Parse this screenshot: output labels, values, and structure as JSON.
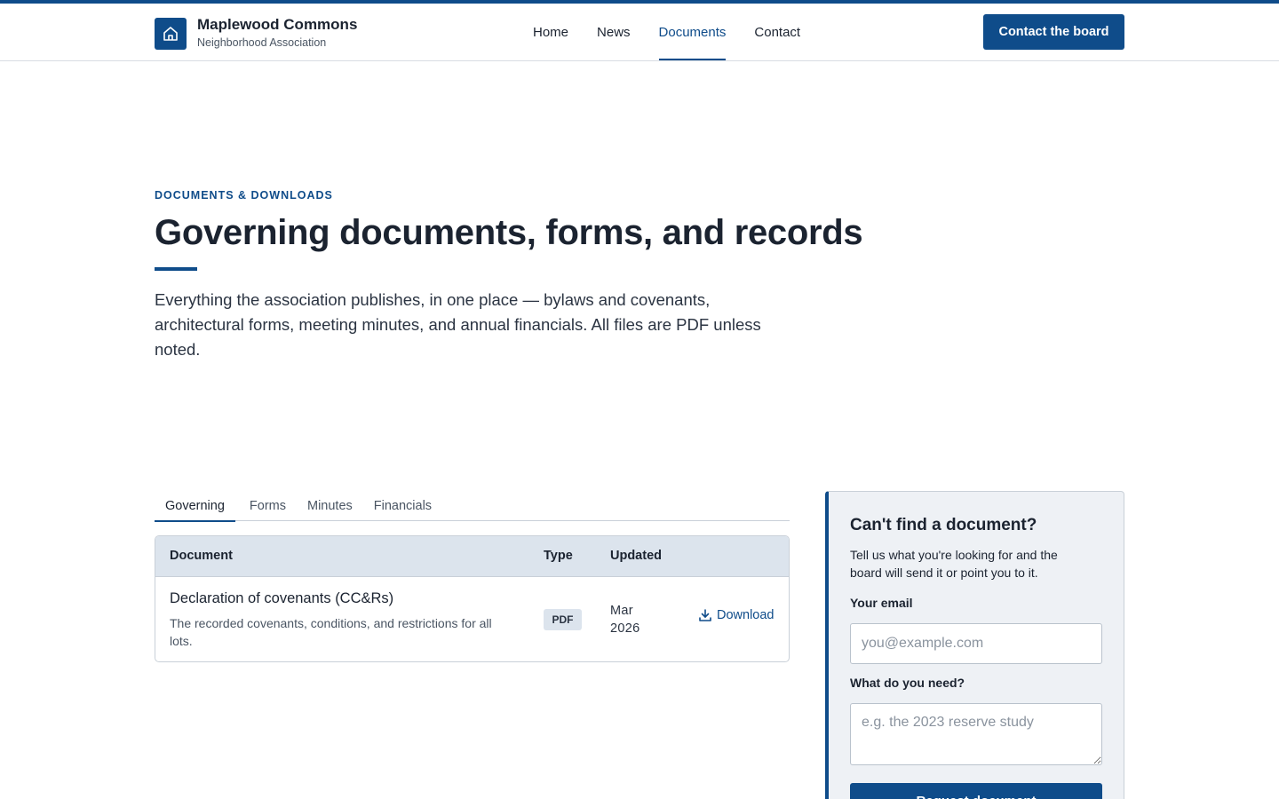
{
  "colors": {
    "brand": "#0f4c8a",
    "header_bg": "#dce4ed",
    "panel_bg": "#eef1f5"
  },
  "header": {
    "brand_title": "Maplewood Commons",
    "brand_subtitle": "Neighborhood Association",
    "logo_icon": "house-icon",
    "nav": [
      {
        "label": "Home",
        "active": false
      },
      {
        "label": "News",
        "active": false
      },
      {
        "label": "Documents",
        "active": true
      },
      {
        "label": "Contact",
        "active": false
      }
    ],
    "cta_label": "Contact the board"
  },
  "hero": {
    "eyebrow": "DOCUMENTS & DOWNLOADS",
    "title": "Governing documents, forms, and records",
    "lead": "Everything the association publishes, in one place — bylaws and covenants, architectural forms, meeting minutes, and annual financials. All files are PDF unless noted."
  },
  "tabs": [
    {
      "label": "Governing",
      "active": true
    },
    {
      "label": "Forms",
      "active": false
    },
    {
      "label": "Minutes",
      "active": false
    },
    {
      "label": "Financials",
      "active": false
    }
  ],
  "table": {
    "columns": [
      "Document",
      "Type",
      "Updated",
      ""
    ],
    "rows": [
      {
        "title": "Declaration of covenants (CC&Rs)",
        "description": "The recorded covenants, conditions, and restrictions for all lots.",
        "type": "PDF",
        "updated": "Mar 2026",
        "action": "Download",
        "action_icon": "download-icon"
      }
    ]
  },
  "request_panel": {
    "title": "Can't find a document?",
    "text": "Tell us what you're looking for and the board will send it or point you to it.",
    "email_label": "Your email",
    "email_placeholder": "you@example.com",
    "email_value": "",
    "need_label": "What do you need?",
    "need_placeholder": "e.g. the 2023 reserve study",
    "need_value": "",
    "submit_label": "Request document"
  }
}
